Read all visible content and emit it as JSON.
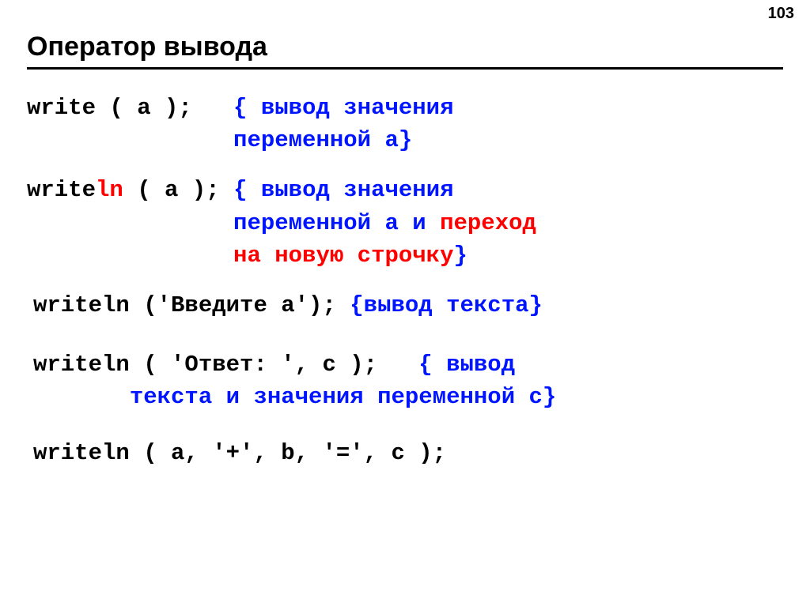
{
  "pageNumber": "103",
  "title": "Оператор вывода",
  "b1": {
    "l1a": "write ( a );   ",
    "l1b": "{ вывод значения",
    "l2": "               переменной a}"
  },
  "b2": {
    "l1a": "write",
    "l1b": "ln",
    "l1c": " ( a ); ",
    "l1d": "{ вывод значения",
    "l2a": "               переменной a и ",
    "l2b": "переход",
    "l3a": "               на новую строчку",
    "l3b": "}"
  },
  "b3": {
    "a": "writeln ('Введите a'); ",
    "b": "{вывод текста}"
  },
  "b4": {
    "l1a": "writeln ( 'Ответ: ', c );   ",
    "l1b": "{ вывод",
    "l2": "       текста и значения переменной c}"
  },
  "b5": "writeln ( a, '+', b, '=', c );"
}
